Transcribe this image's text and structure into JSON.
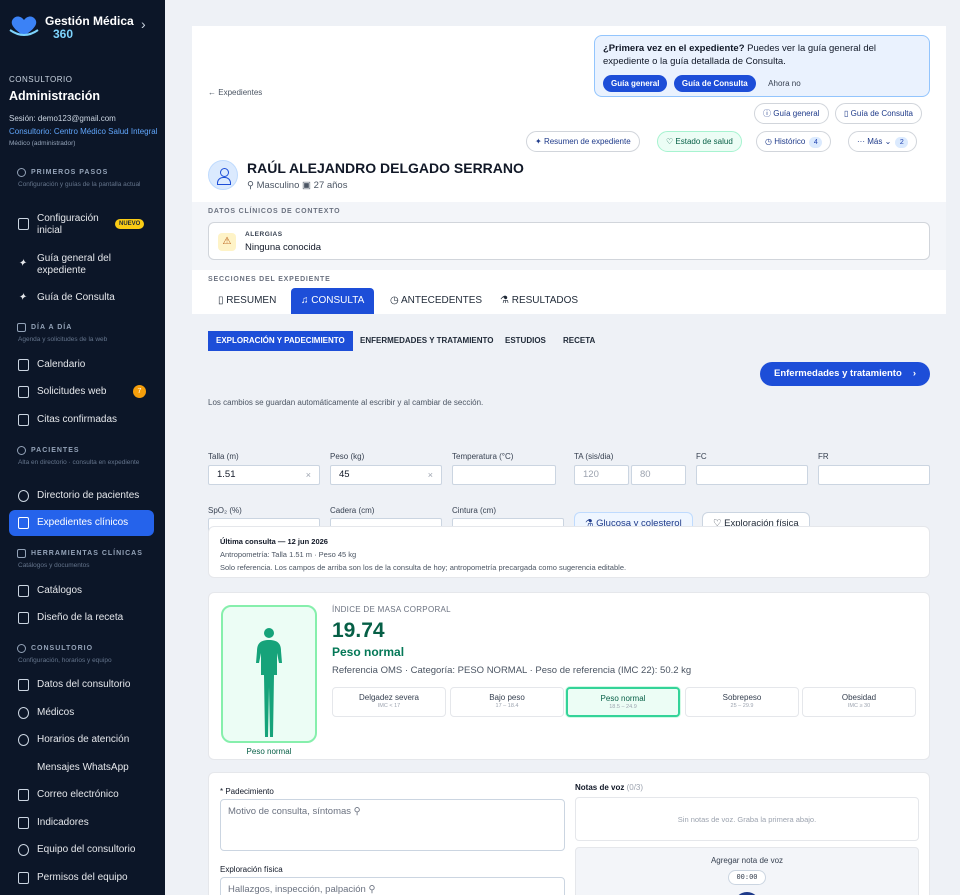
{
  "brand": {
    "name": "Gestión Médica",
    "version": "360"
  },
  "sidebar": {
    "org_label": "CONSULTORIO",
    "admin": "Administración",
    "session": "Sesión: demo123@gmail.com",
    "consultorio": "Consultorio: Centro Médico Salud Integral",
    "role": "Médico (administrador)",
    "sections": [
      {
        "title": "PRIMEROS PASOS",
        "sub": "Configuración y guías de la pantalla actual"
      },
      {
        "title": "DÍA A DÍA",
        "sub": "Agenda y solicitudes de la web"
      },
      {
        "title": "PACIENTES",
        "sub": "Alta en directorio · consulta en expediente"
      },
      {
        "title": "HERRAMIENTAS CLÍNICAS",
        "sub": "Catálogos y documentos"
      },
      {
        "title": "CONSULTORIO",
        "sub": "Configuración, horarios y equipo"
      }
    ],
    "items": [
      {
        "label": "Configuración inicial",
        "badge": "NUEVO"
      },
      {
        "label": "Guía general del expediente"
      },
      {
        "label": "Guía de Consulta"
      },
      {
        "label": "Calendario"
      },
      {
        "label": "Solicitudes web",
        "count": "7"
      },
      {
        "label": "Citas confirmadas"
      },
      {
        "label": "Directorio de pacientes"
      },
      {
        "label": "Expedientes clínicos"
      },
      {
        "label": "Catálogos"
      },
      {
        "label": "Diseño de la receta"
      },
      {
        "label": "Datos del consultorio"
      },
      {
        "label": "Médicos"
      },
      {
        "label": "Horarios de atención"
      },
      {
        "label": "Mensajes WhatsApp"
      },
      {
        "label": "Correo electrónico"
      },
      {
        "label": "Indicadores"
      },
      {
        "label": "Equipo del consultorio"
      },
      {
        "label": "Permisos del equipo"
      }
    ]
  },
  "header": {
    "back": "Expedientes",
    "tip": {
      "q": "¿Primera vez en el expediente?",
      "text": " Puedes ver la guía general del expediente o la guía detallada de Consulta.",
      "b1": "Guía general",
      "b2": "Guía de Consulta",
      "later": "Ahora no"
    },
    "guide1": "Guía general",
    "guide2": "Guía de Consulta",
    "actions": {
      "summary": "Resumen de expediente",
      "health": "Estado de salud",
      "history": "Histórico",
      "history_count": "4",
      "more": "Más",
      "more_count": "2"
    }
  },
  "patient": {
    "name": "RAÚL ALEJANDRO DELGADO SERRANO",
    "sex": "Masculino",
    "age": "27 años"
  },
  "context": {
    "title": "DATOS CLÍNICOS DE CONTEXTO",
    "allergy_label": "ALERGIAS",
    "allergy_value": "Ninguna conocida"
  },
  "sections_title": "SECCIONES DEL EXPEDIENTE",
  "tabs": [
    "RESUMEN",
    "CONSULTA",
    "ANTECEDENTES",
    "RESULTADOS"
  ],
  "subtabs": [
    "EXPLORACIÓN Y PADECIMIENTO",
    "ENFERMEDADES Y TRATAMIENTO",
    "ESTUDIOS",
    "RECETA"
  ],
  "next_button": "Enfermedades y tratamiento",
  "autosave": "Los cambios se guardan automáticamente al escribir y al cambiar de sección.",
  "fields": {
    "talla": {
      "label": "Talla (m)",
      "value": "1.51"
    },
    "peso": {
      "label": "Peso (kg)",
      "value": "45"
    },
    "temp": {
      "label": "Temperatura (°C)"
    },
    "ta": {
      "label": "TA (sis/dia)",
      "sis": "120",
      "dia": "80"
    },
    "fc": {
      "label": "FC"
    },
    "fr": {
      "label": "FR"
    },
    "spo2": {
      "label": "SpO₂ (%)"
    },
    "cadera": {
      "label": "Cadera (cm)"
    },
    "cintura": {
      "label": "Cintura (cm)"
    },
    "glucosa": "Glucosa y colesterol",
    "exploracion": "Exploración física"
  },
  "last": {
    "title": "Última consulta — 12 jun 2026",
    "antro": "Antropometría: Talla 1.51 m · Peso 45 kg",
    "note": "Solo referencia. Los campos de arriba son los de la consulta de hoy; antropometría precargada como sugerencia editable."
  },
  "imc": {
    "title": "ÍNDICE DE MASA CORPORAL",
    "value": "19.74",
    "category": "Peso normal",
    "ref": "Referencia OMS · Categoría: PESO NORMAL · Peso de referencia (IMC 22): 50.2 kg",
    "figure_label": "Peso normal",
    "cats": [
      {
        "n": "Delgadez severa",
        "r": "IMC < 17"
      },
      {
        "n": "Bajo peso",
        "r": "17 – 18.4"
      },
      {
        "n": "Peso normal",
        "r": "18.5 – 24.9"
      },
      {
        "n": "Sobrepeso",
        "r": "25 – 29.9"
      },
      {
        "n": "Obesidad",
        "r": "IMC ≥ 30"
      }
    ]
  },
  "pad": {
    "label": "* Padecimiento",
    "placeholder": "Motivo de consulta, síntomas",
    "expl_label": "Exploración física",
    "expl_placeholder": "Hallazgos, inspección, palpación",
    "voice_title": "Notas de voz",
    "voice_count": "(0/3)",
    "voice_empty": "Sin notas de voz. Graba la primera abajo.",
    "add_voice": "Agregar nota de voz",
    "timer": "00:00"
  },
  "colors": {
    "primary": "#1d4ed8",
    "sidebar": "#0c1628",
    "normal": "#065f46"
  }
}
